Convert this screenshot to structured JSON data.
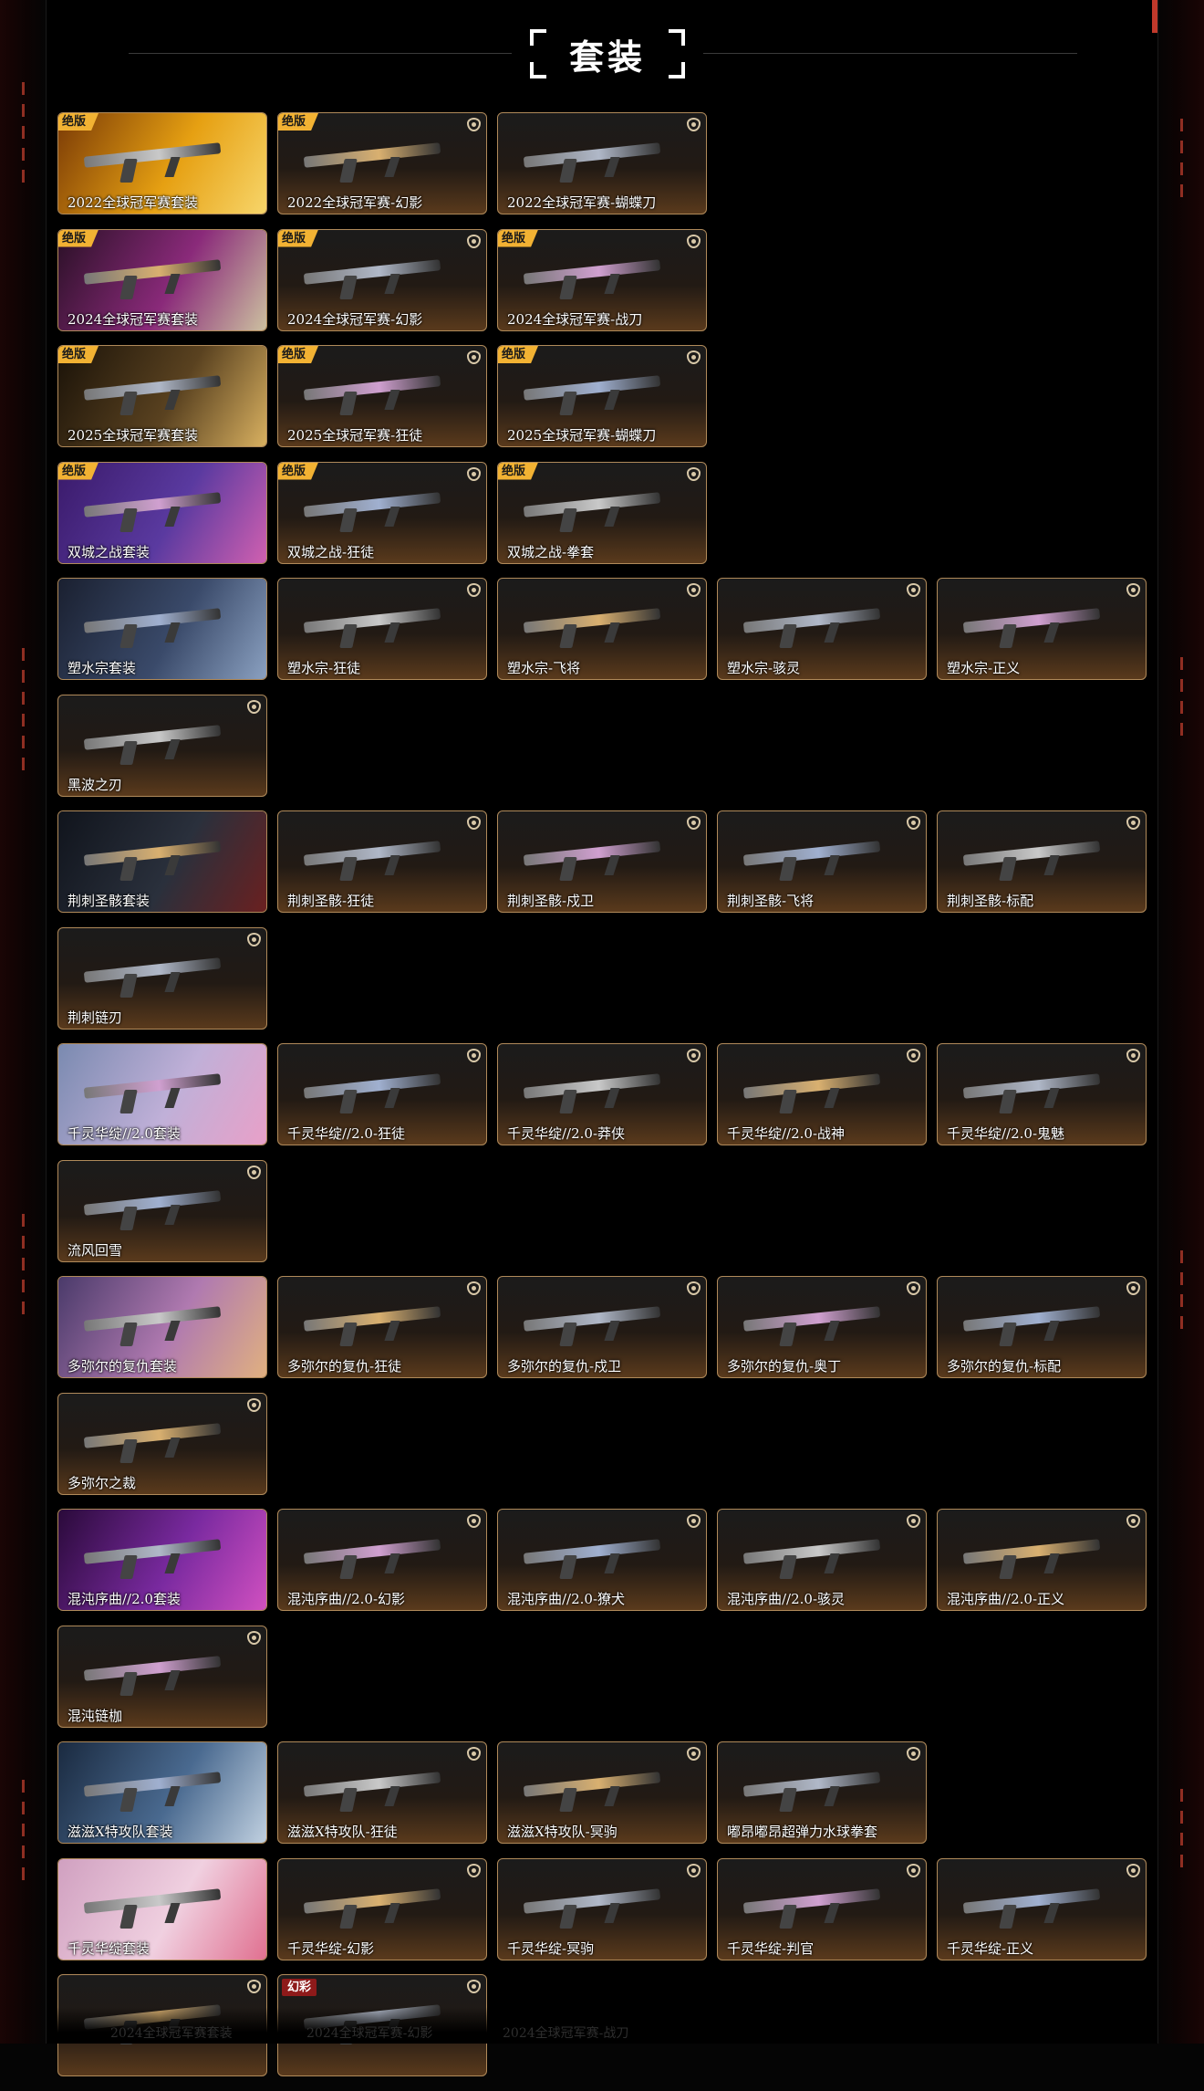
{
  "page": {
    "title": "套装"
  },
  "badges": {
    "limited": "绝版",
    "variant": "幻彩"
  },
  "rows": [
    [
      {
        "label": "2022全球冠军赛套装",
        "badge": "limited",
        "bundle": true,
        "colors": [
          "#7a3a06",
          "#e6a012",
          "#f7d56a"
        ]
      },
      {
        "label": "2022全球冠军赛-幻影",
        "badge": "limited"
      },
      {
        "label": "2022全球冠军赛-蝴蝶刀"
      }
    ],
    [
      {
        "label": "2024全球冠军赛套装",
        "badge": "limited",
        "bundle": true,
        "colors": [
          "#2a1026",
          "#8a2a7a",
          "#ccc0a0"
        ]
      },
      {
        "label": "2024全球冠军赛-幻影",
        "badge": "limited"
      },
      {
        "label": "2024全球冠军赛-战刀",
        "badge": "limited"
      }
    ],
    [
      {
        "label": "2025全球冠军赛套装",
        "badge": "limited",
        "bundle": true,
        "colors": [
          "#1a1208",
          "#5a4220",
          "#d8b060"
        ]
      },
      {
        "label": "2025全球冠军赛-狂徒",
        "badge": "limited"
      },
      {
        "label": "2025全球冠军赛-蝴蝶刀",
        "badge": "limited"
      }
    ],
    [
      {
        "label": "双城之战套装",
        "badge": "limited",
        "bundle": true,
        "colors": [
          "#3a1a6a",
          "#5a3aa0",
          "#d060b0"
        ]
      },
      {
        "label": "双城之战-狂徒",
        "badge": "limited"
      },
      {
        "label": "双城之战-拳套",
        "badge": "limited"
      }
    ],
    [
      {
        "label": "塑水宗套装",
        "bundle": true,
        "colors": [
          "#1a2030",
          "#3a4a6a",
          "#8aa0c0"
        ]
      },
      {
        "label": "塑水宗-狂徒"
      },
      {
        "label": "塑水宗-飞将"
      },
      {
        "label": "塑水宗-骇灵"
      },
      {
        "label": "塑水宗-正义"
      }
    ],
    [
      {
        "label": "黑波之刃"
      }
    ],
    [
      {
        "label": "荆刺圣骸套装",
        "bundle": true,
        "colors": [
          "#10141c",
          "#2a303c",
          "#6a2020"
        ]
      },
      {
        "label": "荆刺圣骸-狂徒"
      },
      {
        "label": "荆刺圣骸-戍卫"
      },
      {
        "label": "荆刺圣骸-飞将"
      },
      {
        "label": "荆刺圣骸-标配"
      }
    ],
    [
      {
        "label": "荆刺链刃"
      }
    ],
    [
      {
        "label": "千灵华绽//2.0套装",
        "bundle": true,
        "colors": [
          "#7a8ab0",
          "#c0b0d8",
          "#e8a0c8"
        ]
      },
      {
        "label": "千灵华绽//2.0-狂徒"
      },
      {
        "label": "千灵华绽//2.0-莽侠"
      },
      {
        "label": "千灵华绽//2.0-战神"
      },
      {
        "label": "千灵华绽//2.0-鬼魅"
      }
    ],
    [
      {
        "label": "流风回雪"
      }
    ],
    [
      {
        "label": "多弥尔的复仇套装",
        "bundle": true,
        "colors": [
          "#4a3a6a",
          "#b07ab0",
          "#e0b080"
        ]
      },
      {
        "label": "多弥尔的复仇-狂徒"
      },
      {
        "label": "多弥尔的复仇-戍卫"
      },
      {
        "label": "多弥尔的复仇-奥丁"
      },
      {
        "label": "多弥尔的复仇-标配"
      }
    ],
    [
      {
        "label": "多弥尔之裁"
      }
    ],
    [
      {
        "label": "混沌序曲//2.0套装",
        "bundle": true,
        "colors": [
          "#2a0a3a",
          "#7a2aa0",
          "#d050c0"
        ]
      },
      {
        "label": "混沌序曲//2.0-幻影"
      },
      {
        "label": "混沌序曲//2.0-獠犬"
      },
      {
        "label": "混沌序曲//2.0-骇灵"
      },
      {
        "label": "混沌序曲//2.0-正义"
      }
    ],
    [
      {
        "label": "混沌链枷"
      }
    ],
    [
      {
        "label": "滋滋X特攻队套装",
        "bundle": true,
        "colors": [
          "#1a2a40",
          "#4a6a90",
          "#c0d0e0"
        ]
      },
      {
        "label": "滋滋X特攻队-狂徒"
      },
      {
        "label": "滋滋X特攻队-冥驹"
      },
      {
        "label": "嘟昂嘟昂超弹力水球拳套"
      }
    ],
    [
      {
        "label": "千灵华绽套装",
        "bundle": true,
        "colors": [
          "#d0a0c0",
          "#f0d0e0",
          "#e07090"
        ]
      },
      {
        "label": "千灵华绽-幻影"
      },
      {
        "label": "千灵华绽-冥驹"
      },
      {
        "label": "千灵华绽-判官"
      },
      {
        "label": "千灵华绽-正义"
      }
    ],
    [
      {
        "label": ""
      },
      {
        "label": "",
        "badge": "variant"
      }
    ]
  ],
  "ghost_labels": [
    "2024全球冠军赛套装",
    "2024全球冠军赛-幻影",
    "2024全球冠军赛-战刀"
  ]
}
